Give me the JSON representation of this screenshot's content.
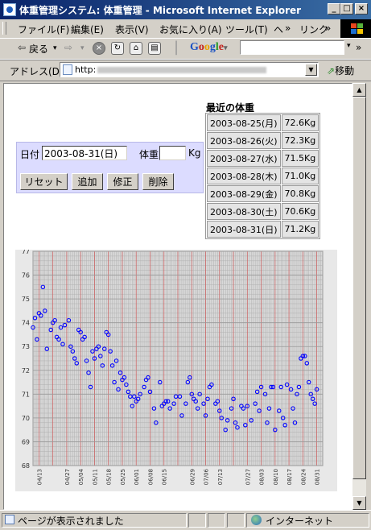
{
  "window": {
    "title": "体重管理システム: 体重管理 - Microsoft Internet Explorer"
  },
  "menu": {
    "items": [
      "ファイル(F)",
      "編集(E)",
      "表示(V)",
      "お気に入り(A)",
      "ツール(T)",
      "ヘ"
    ],
    "more": "»",
    "links_label": "リンク",
    "links_more": "»"
  },
  "toolbar": {
    "back_label": "戻る",
    "google_label": "Google",
    "more": "»"
  },
  "address": {
    "label": "アドレス(D)",
    "url_prefix": "http:",
    "go_label": "移動"
  },
  "form": {
    "date_label": "日付",
    "date_value": "2003-08-31(日)",
    "weight_label": "体重",
    "weight_value": "",
    "unit": "Kg",
    "reset": "リセット",
    "add": "追加",
    "modify": "修正",
    "delete": "削除"
  },
  "recent": {
    "title": "最近の体重",
    "rows": [
      {
        "date": "2003-08-25(月)",
        "weight": "72.6Kg"
      },
      {
        "date": "2003-08-26(火)",
        "weight": "72.3Kg"
      },
      {
        "date": "2003-08-27(水)",
        "weight": "71.5Kg"
      },
      {
        "date": "2003-08-28(木)",
        "weight": "71.0Kg"
      },
      {
        "date": "2003-08-29(金)",
        "weight": "70.8Kg"
      },
      {
        "date": "2003-08-30(土)",
        "weight": "70.6Kg"
      },
      {
        "date": "2003-08-31(日)",
        "weight": "71.2Kg"
      }
    ]
  },
  "status": {
    "text": "ページが表示されました",
    "zone": "インターネット"
  },
  "colors": {
    "form_bg": "#dcdcff",
    "point": "#0000ff",
    "major_grid": "#cc6666",
    "minor_grid": "#b0b0b0",
    "title_bar": "#0a246a"
  },
  "chart_data": {
    "type": "scatter",
    "title": "",
    "xlabel": "",
    "ylabel": "",
    "ylim": [
      68,
      77
    ],
    "yticks": [
      "68",
      "69",
      "70",
      "71",
      "72",
      "73",
      "74",
      "75",
      "76",
      "77"
    ],
    "xlim": [
      "2003-04-10",
      "2003-09-03"
    ],
    "xticks": [
      "04/13",
      "04/27",
      "05/04",
      "05/11",
      "05/18",
      "05/25",
      "06/01",
      "06/08",
      "06/15",
      "06/29",
      "07/06",
      "07/13",
      "07/27",
      "08/03",
      "08/10",
      "08/17",
      "08/24",
      "08/31"
    ],
    "grid": true,
    "x": [
      "2003-04-10",
      "2003-04-11",
      "2003-04-12",
      "2003-04-13",
      "2003-04-14",
      "2003-04-15",
      "2003-04-16",
      "2003-04-17",
      "2003-04-19",
      "2003-04-20",
      "2003-04-21",
      "2003-04-22",
      "2003-04-23",
      "2003-04-24",
      "2003-04-25",
      "2003-04-26",
      "2003-04-28",
      "2003-04-29",
      "2003-04-30",
      "2003-05-01",
      "2003-05-02",
      "2003-05-03",
      "2003-05-04",
      "2003-05-05",
      "2003-05-06",
      "2003-05-07",
      "2003-05-08",
      "2003-05-09",
      "2003-05-10",
      "2003-05-11",
      "2003-05-12",
      "2003-05-13",
      "2003-05-14",
      "2003-05-15",
      "2003-05-16",
      "2003-05-17",
      "2003-05-18",
      "2003-05-19",
      "2003-05-20",
      "2003-05-21",
      "2003-05-22",
      "2003-05-23",
      "2003-05-24",
      "2003-05-25",
      "2003-05-26",
      "2003-05-27",
      "2003-05-28",
      "2003-05-29",
      "2003-05-30",
      "2003-05-31",
      "2003-06-01",
      "2003-06-02",
      "2003-06-03",
      "2003-06-05",
      "2003-06-06",
      "2003-06-07",
      "2003-06-08",
      "2003-06-10",
      "2003-06-11",
      "2003-06-13",
      "2003-06-14",
      "2003-06-15",
      "2003-06-16",
      "2003-06-17",
      "2003-06-18",
      "2003-06-20",
      "2003-06-21",
      "2003-06-23",
      "2003-06-24",
      "2003-06-26",
      "2003-06-27",
      "2003-06-28",
      "2003-06-29",
      "2003-06-30",
      "2003-07-01",
      "2003-07-02",
      "2003-07-03",
      "2003-07-05",
      "2003-07-06",
      "2003-07-07",
      "2003-07-08",
      "2003-07-09",
      "2003-07-11",
      "2003-07-12",
      "2003-07-13",
      "2003-07-14",
      "2003-07-16",
      "2003-07-17",
      "2003-07-19",
      "2003-07-20",
      "2003-07-21",
      "2003-07-22",
      "2003-07-24",
      "2003-07-25",
      "2003-07-26",
      "2003-07-27",
      "2003-07-29",
      "2003-07-31",
      "2003-08-01",
      "2003-08-02",
      "2003-08-03",
      "2003-08-05",
      "2003-08-06",
      "2003-08-07",
      "2003-08-08",
      "2003-08-09",
      "2003-08-10",
      "2003-08-12",
      "2003-08-13",
      "2003-08-14",
      "2003-08-15",
      "2003-08-16",
      "2003-08-18",
      "2003-08-19",
      "2003-08-20",
      "2003-08-21",
      "2003-08-22",
      "2003-08-23",
      "2003-08-24",
      "2003-08-25",
      "2003-08-26",
      "2003-08-27",
      "2003-08-28",
      "2003-08-29",
      "2003-08-30",
      "2003-08-31"
    ],
    "y": [
      73.8,
      74.2,
      73.3,
      74.4,
      74.3,
      75.5,
      74.5,
      72.9,
      73.7,
      74.0,
      74.1,
      73.4,
      73.3,
      73.8,
      73.1,
      73.9,
      74.1,
      73.0,
      72.8,
      72.5,
      72.3,
      73.7,
      73.6,
      73.3,
      73.4,
      72.4,
      71.9,
      71.3,
      72.8,
      72.5,
      72.9,
      73.0,
      72.6,
      72.2,
      72.9,
      73.6,
      73.5,
      72.8,
      72.2,
      71.5,
      72.4,
      71.2,
      71.9,
      71.6,
      71.7,
      71.4,
      71.1,
      70.9,
      70.5,
      70.9,
      70.7,
      70.8,
      71.0,
      71.3,
      71.6,
      71.7,
      71.1,
      70.4,
      69.8,
      71.5,
      70.5,
      70.6,
      70.7,
      70.7,
      70.4,
      70.6,
      70.9,
      70.9,
      70.1,
      70.6,
      71.5,
      71.7,
      71.0,
      70.8,
      70.7,
      70.4,
      71.0,
      70.6,
      70.1,
      70.8,
      71.3,
      71.4,
      70.6,
      70.7,
      70.3,
      70.0,
      69.5,
      69.9,
      70.4,
      70.8,
      69.8,
      69.6,
      70.5,
      70.4,
      69.7,
      70.5,
      69.9,
      70.6,
      71.1,
      70.3,
      71.3,
      71.0,
      69.8,
      70.4,
      71.3,
      71.3,
      69.5,
      70.3,
      71.3,
      70.0,
      69.7,
      71.4,
      71.2,
      70.4,
      69.8,
      71.0,
      71.3,
      72.5,
      72.6,
      72.6,
      72.3,
      71.5,
      71.0,
      70.8,
      70.6,
      71.2
    ]
  }
}
